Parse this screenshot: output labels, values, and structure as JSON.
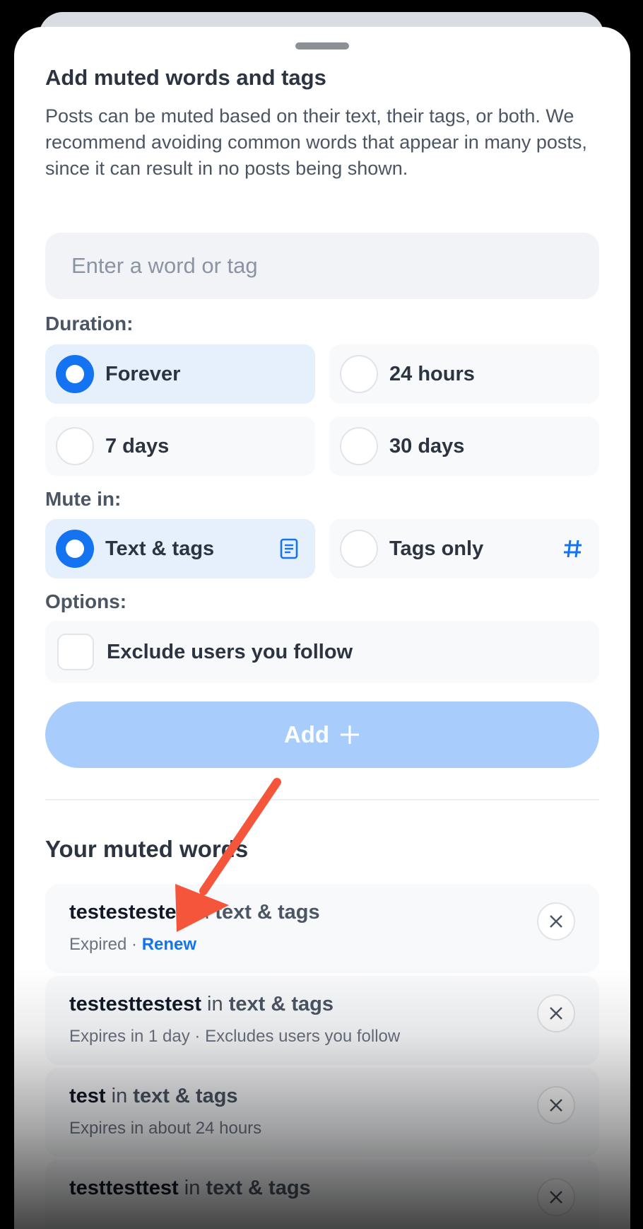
{
  "sheet": {
    "title": "Add muted words and tags",
    "description": "Posts can be muted based on their text, their tags, or both. We recommend avoiding common words that appear in many posts, since it can result in no posts being shown.",
    "input_placeholder": "Enter a word or tag"
  },
  "duration": {
    "label": "Duration:",
    "options": [
      {
        "label": "Forever",
        "selected": true
      },
      {
        "label": "24 hours",
        "selected": false
      },
      {
        "label": "7 days",
        "selected": false
      },
      {
        "label": "30 days",
        "selected": false
      }
    ]
  },
  "mute_in": {
    "label": "Mute in:",
    "options": [
      {
        "label": "Text & tags",
        "selected": true,
        "icon": "document-icon"
      },
      {
        "label": "Tags only",
        "selected": false,
        "icon": "hashtag-icon"
      }
    ]
  },
  "options": {
    "label": "Options:",
    "exclude_label": "Exclude users you follow",
    "exclude_checked": false
  },
  "add_button": {
    "label": "Add",
    "icon": "plus-icon"
  },
  "muted_words": {
    "title": "Your muted words",
    "items": [
      {
        "word": "testestestes",
        "connector": "in",
        "scope": "text & tags",
        "status": "Expired · ",
        "action": "Renew"
      },
      {
        "word": "testesttestest",
        "connector": "in",
        "scope": "text & tags",
        "status": "Expires in 1 day · Excludes users you follow"
      },
      {
        "word": "test",
        "connector": "in",
        "scope": "text & tags",
        "status": "Expires in about 24 hours"
      },
      {
        "word": "testtesttest",
        "connector": "in",
        "scope": "text & tags",
        "status": ""
      }
    ]
  },
  "colors": {
    "accent": "#1473f1",
    "annotation_arrow": "#f4553b",
    "add_button_disabled": "#a8cdfc"
  }
}
